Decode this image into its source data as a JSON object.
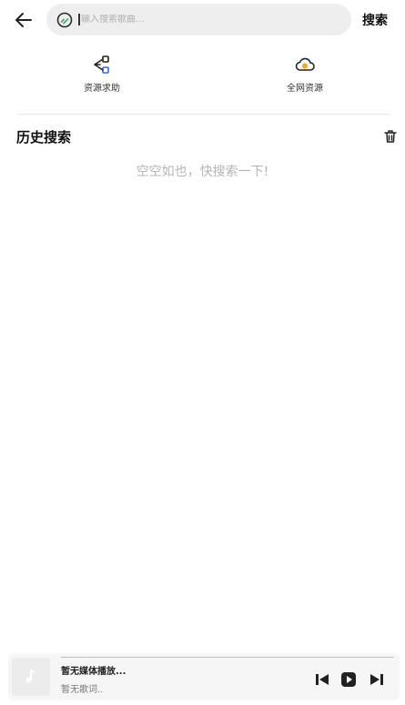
{
  "topbar": {
    "search_placeholder": "输入搜索歌曲...",
    "search_button": "搜索"
  },
  "quick_actions": [
    {
      "label": "资源求助",
      "icon": "share-nodes-icon"
    },
    {
      "label": "全网资源",
      "icon": "cloud-icon"
    }
  ],
  "history": {
    "title": "历史搜索",
    "empty_text": "空空如也，快搜索一下!"
  },
  "player": {
    "title": "暂无媒体播放...",
    "lyric": "暂无歌词.."
  },
  "colors": {
    "accent_blue": "#2f6be6",
    "accent_orange": "#f5a623",
    "text_dark": "#111111",
    "muted": "#b5b5b5"
  }
}
